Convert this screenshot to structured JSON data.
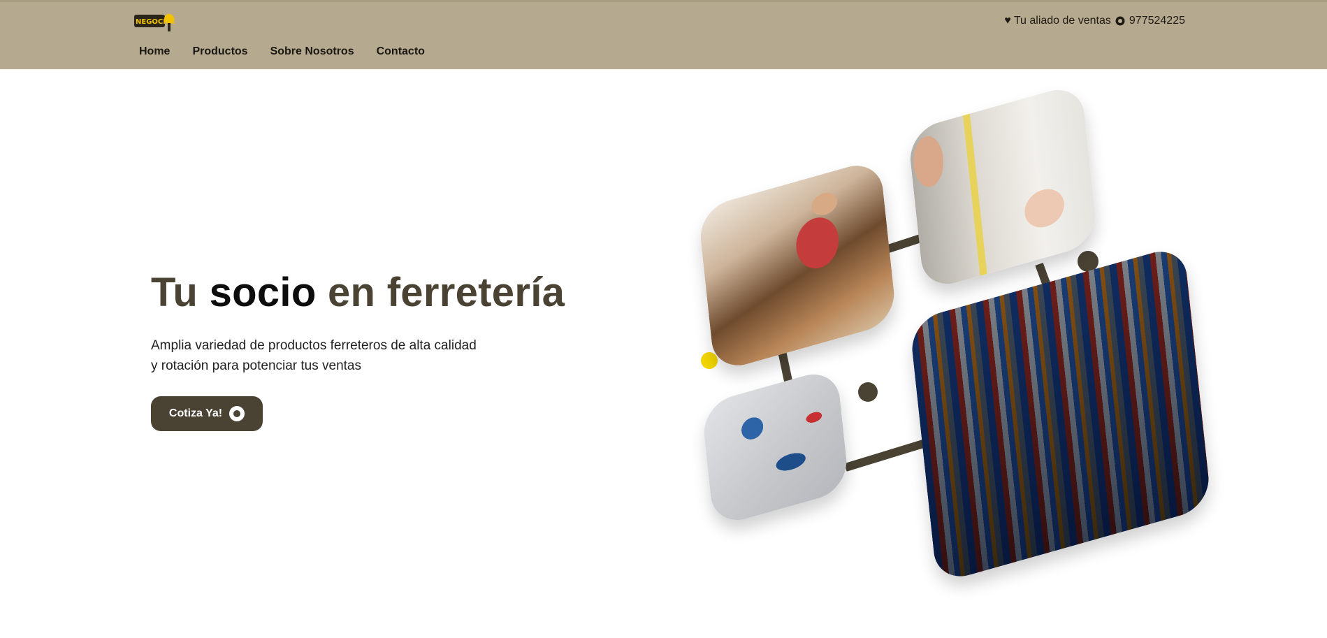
{
  "header": {
    "logo_alt": "NEGOCIOS",
    "tagline": "♥ Tu aliado de ventas",
    "phone": "977524225",
    "nav": [
      "Home",
      "Productos",
      "Sobre Nosotros",
      "Contacto"
    ]
  },
  "hero": {
    "title_part1": "Tu ",
    "title_strong": "socio",
    "title_part2": " en ferretería",
    "description": "Amplia variedad de productos ferreteros de alta calidad y rotación para potenciar tus ventas",
    "cta_label": "Cotiza Ya!"
  },
  "colors": {
    "header_bg": "#b5a98f",
    "accent_dark": "#4a4334",
    "accent_yellow": "#f2d600"
  },
  "icons": {
    "logo": "hardware-store-logo",
    "heart": "heart-icon",
    "whatsapp": "whatsapp-icon"
  }
}
